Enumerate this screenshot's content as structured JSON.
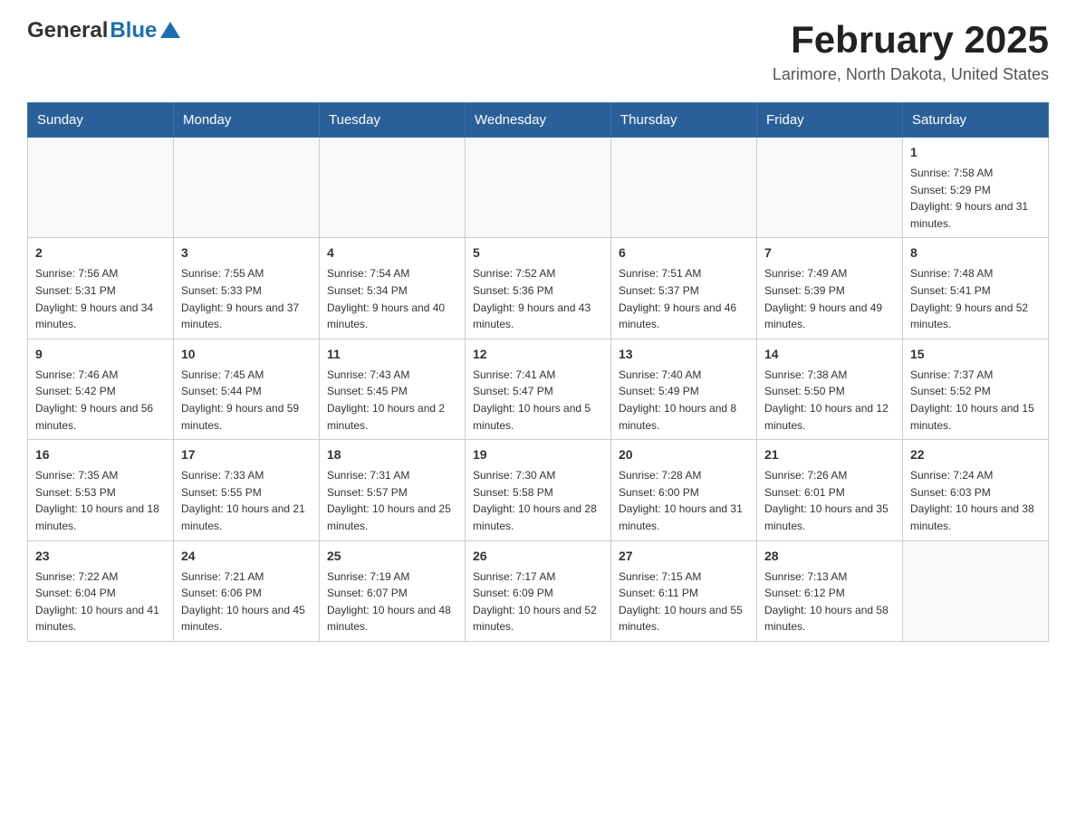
{
  "header": {
    "logo_general": "General",
    "logo_blue": "Blue",
    "title": "February 2025",
    "subtitle": "Larimore, North Dakota, United States"
  },
  "days_of_week": [
    "Sunday",
    "Monday",
    "Tuesday",
    "Wednesday",
    "Thursday",
    "Friday",
    "Saturday"
  ],
  "weeks": [
    [
      {
        "day": "",
        "info": ""
      },
      {
        "day": "",
        "info": ""
      },
      {
        "day": "",
        "info": ""
      },
      {
        "day": "",
        "info": ""
      },
      {
        "day": "",
        "info": ""
      },
      {
        "day": "",
        "info": ""
      },
      {
        "day": "1",
        "info": "Sunrise: 7:58 AM\nSunset: 5:29 PM\nDaylight: 9 hours and 31 minutes."
      }
    ],
    [
      {
        "day": "2",
        "info": "Sunrise: 7:56 AM\nSunset: 5:31 PM\nDaylight: 9 hours and 34 minutes."
      },
      {
        "day": "3",
        "info": "Sunrise: 7:55 AM\nSunset: 5:33 PM\nDaylight: 9 hours and 37 minutes."
      },
      {
        "day": "4",
        "info": "Sunrise: 7:54 AM\nSunset: 5:34 PM\nDaylight: 9 hours and 40 minutes."
      },
      {
        "day": "5",
        "info": "Sunrise: 7:52 AM\nSunset: 5:36 PM\nDaylight: 9 hours and 43 minutes."
      },
      {
        "day": "6",
        "info": "Sunrise: 7:51 AM\nSunset: 5:37 PM\nDaylight: 9 hours and 46 minutes."
      },
      {
        "day": "7",
        "info": "Sunrise: 7:49 AM\nSunset: 5:39 PM\nDaylight: 9 hours and 49 minutes."
      },
      {
        "day": "8",
        "info": "Sunrise: 7:48 AM\nSunset: 5:41 PM\nDaylight: 9 hours and 52 minutes."
      }
    ],
    [
      {
        "day": "9",
        "info": "Sunrise: 7:46 AM\nSunset: 5:42 PM\nDaylight: 9 hours and 56 minutes."
      },
      {
        "day": "10",
        "info": "Sunrise: 7:45 AM\nSunset: 5:44 PM\nDaylight: 9 hours and 59 minutes."
      },
      {
        "day": "11",
        "info": "Sunrise: 7:43 AM\nSunset: 5:45 PM\nDaylight: 10 hours and 2 minutes."
      },
      {
        "day": "12",
        "info": "Sunrise: 7:41 AM\nSunset: 5:47 PM\nDaylight: 10 hours and 5 minutes."
      },
      {
        "day": "13",
        "info": "Sunrise: 7:40 AM\nSunset: 5:49 PM\nDaylight: 10 hours and 8 minutes."
      },
      {
        "day": "14",
        "info": "Sunrise: 7:38 AM\nSunset: 5:50 PM\nDaylight: 10 hours and 12 minutes."
      },
      {
        "day": "15",
        "info": "Sunrise: 7:37 AM\nSunset: 5:52 PM\nDaylight: 10 hours and 15 minutes."
      }
    ],
    [
      {
        "day": "16",
        "info": "Sunrise: 7:35 AM\nSunset: 5:53 PM\nDaylight: 10 hours and 18 minutes."
      },
      {
        "day": "17",
        "info": "Sunrise: 7:33 AM\nSunset: 5:55 PM\nDaylight: 10 hours and 21 minutes."
      },
      {
        "day": "18",
        "info": "Sunrise: 7:31 AM\nSunset: 5:57 PM\nDaylight: 10 hours and 25 minutes."
      },
      {
        "day": "19",
        "info": "Sunrise: 7:30 AM\nSunset: 5:58 PM\nDaylight: 10 hours and 28 minutes."
      },
      {
        "day": "20",
        "info": "Sunrise: 7:28 AM\nSunset: 6:00 PM\nDaylight: 10 hours and 31 minutes."
      },
      {
        "day": "21",
        "info": "Sunrise: 7:26 AM\nSunset: 6:01 PM\nDaylight: 10 hours and 35 minutes."
      },
      {
        "day": "22",
        "info": "Sunrise: 7:24 AM\nSunset: 6:03 PM\nDaylight: 10 hours and 38 minutes."
      }
    ],
    [
      {
        "day": "23",
        "info": "Sunrise: 7:22 AM\nSunset: 6:04 PM\nDaylight: 10 hours and 41 minutes."
      },
      {
        "day": "24",
        "info": "Sunrise: 7:21 AM\nSunset: 6:06 PM\nDaylight: 10 hours and 45 minutes."
      },
      {
        "day": "25",
        "info": "Sunrise: 7:19 AM\nSunset: 6:07 PM\nDaylight: 10 hours and 48 minutes."
      },
      {
        "day": "26",
        "info": "Sunrise: 7:17 AM\nSunset: 6:09 PM\nDaylight: 10 hours and 52 minutes."
      },
      {
        "day": "27",
        "info": "Sunrise: 7:15 AM\nSunset: 6:11 PM\nDaylight: 10 hours and 55 minutes."
      },
      {
        "day": "28",
        "info": "Sunrise: 7:13 AM\nSunset: 6:12 PM\nDaylight: 10 hours and 58 minutes."
      },
      {
        "day": "",
        "info": ""
      }
    ]
  ]
}
